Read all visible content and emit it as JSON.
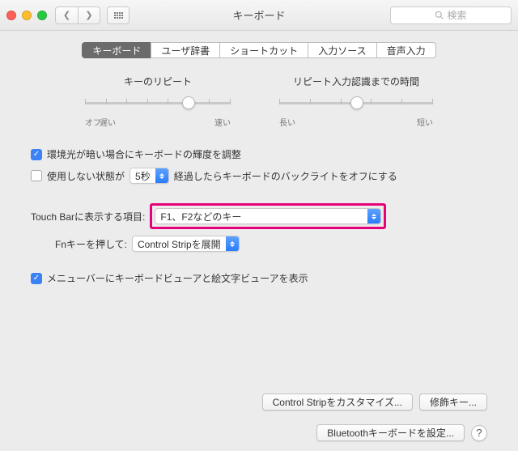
{
  "window": {
    "title": "キーボード"
  },
  "search": {
    "placeholder": "検索"
  },
  "tabs": [
    "キーボード",
    "ユーザ辞書",
    "ショートカット",
    "入力ソース",
    "音声入力"
  ],
  "sliders": {
    "repeat": {
      "label": "キーのリピート",
      "left": "オフ",
      "mid": "遅い",
      "right": "速い"
    },
    "delay": {
      "label": "リピート入力認識までの時間",
      "left": "長い",
      "right": "短い"
    }
  },
  "checks": {
    "dim": "環境光が暗い場合にキーボードの輝度を調整",
    "idle_pre": "使用しない状態が",
    "idle_val": "5秒",
    "idle_post": "経過したらキーボードのバックライトをオフにする",
    "viewer": "メニューバーにキーボードビューアと絵文字ビューアを表示"
  },
  "touchbar": {
    "label": "Touch Barに表示する項目:",
    "value": "F1、F2などのキー"
  },
  "fn": {
    "label": "Fnキーを押して:",
    "value": "Control Stripを展開"
  },
  "buttons": {
    "customize": "Control Stripをカスタマイズ...",
    "modifier": "修飾キー...",
    "bluetooth": "Bluetoothキーボードを設定..."
  }
}
